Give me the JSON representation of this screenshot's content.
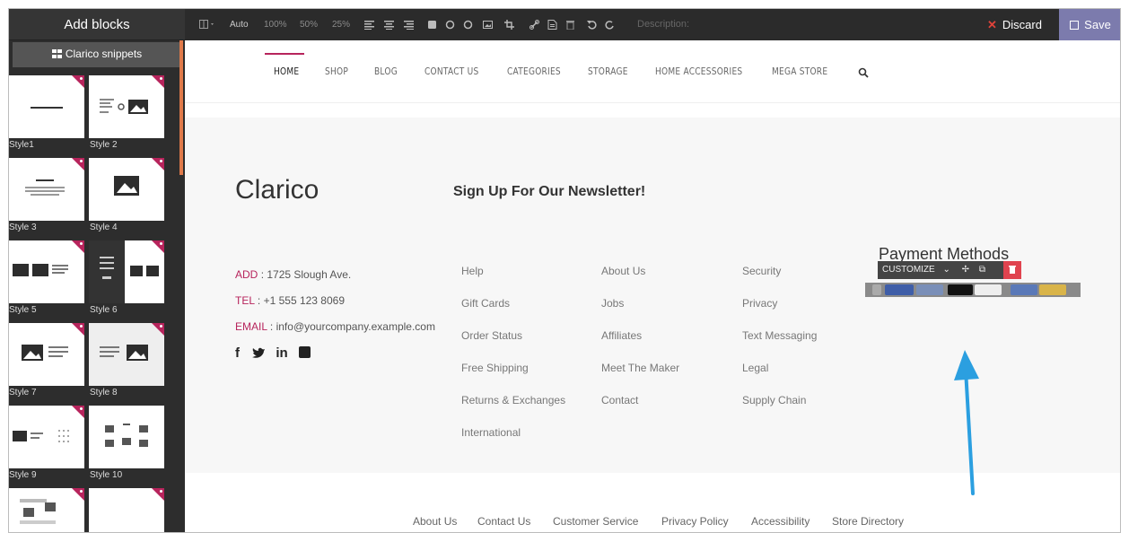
{
  "sidebar": {
    "title": "Add blocks",
    "snippets_label": "Clarico snippets",
    "styles": [
      "Style1",
      "Style 2",
      "Style 3",
      "Style 4",
      "Style 5",
      "Style 6",
      "Style 7",
      "Style 8",
      "Style 9",
      "Style 10"
    ]
  },
  "toolbar": {
    "auto": "Auto",
    "zoom_100": "100%",
    "zoom_50": "50%",
    "zoom_25": "25%",
    "description_label": "Description:",
    "discard_label": "Discard",
    "save_label": "Save",
    "icons": [
      "layout-icon",
      "align-left-icon",
      "align-center-icon",
      "align-right-icon",
      "square-icon",
      "circle-icon",
      "circle-outline-icon",
      "image-icon",
      "crop-icon",
      "link-icon",
      "file-icon",
      "trash-icon",
      "undo-icon",
      "redo-icon"
    ]
  },
  "nav": {
    "items": [
      "HOME",
      "SHOP",
      "BLOG",
      "CONTACT US",
      "CATEGORIES",
      "STORAGE",
      "HOME ACCESSORIES",
      "MEGA STORE"
    ],
    "search_icon": "search-icon"
  },
  "footer": {
    "brand": "Clarico",
    "newsletter_title": "Sign Up For Our Newsletter!",
    "contact": {
      "add_label": "ADD",
      "add_value": ": 1725 Slough Ave.",
      "tel_label": "TEL",
      "tel_value": ": +1 555 123 8069",
      "email_label": "EMAIL",
      "email_value": ": info@yourcompany.example.com"
    },
    "social": [
      "facebook-icon",
      "twitter-icon",
      "linkedin-icon",
      "google-plus-icon"
    ],
    "col1": [
      "Help",
      "Gift Cards",
      "Order Status",
      "Free Shipping",
      "Returns & Exchanges",
      "International"
    ],
    "col2": [
      "About Us",
      "Jobs",
      "Affiliates",
      "Meet The Maker",
      "Contact"
    ],
    "col3": [
      "Security",
      "Privacy",
      "Text Messaging",
      "Legal",
      "Supply Chain"
    ],
    "payment_title": "Payment Methods",
    "customize_label": "CUSTOMIZE"
  },
  "bottom_links": [
    "About Us",
    "Contact Us",
    "Customer Service",
    "Privacy Policy",
    "Accessibility",
    "Store Directory"
  ],
  "colors": {
    "accent": "#b7245c",
    "save": "#7c7bad",
    "arrow": "#2b9fe0"
  }
}
